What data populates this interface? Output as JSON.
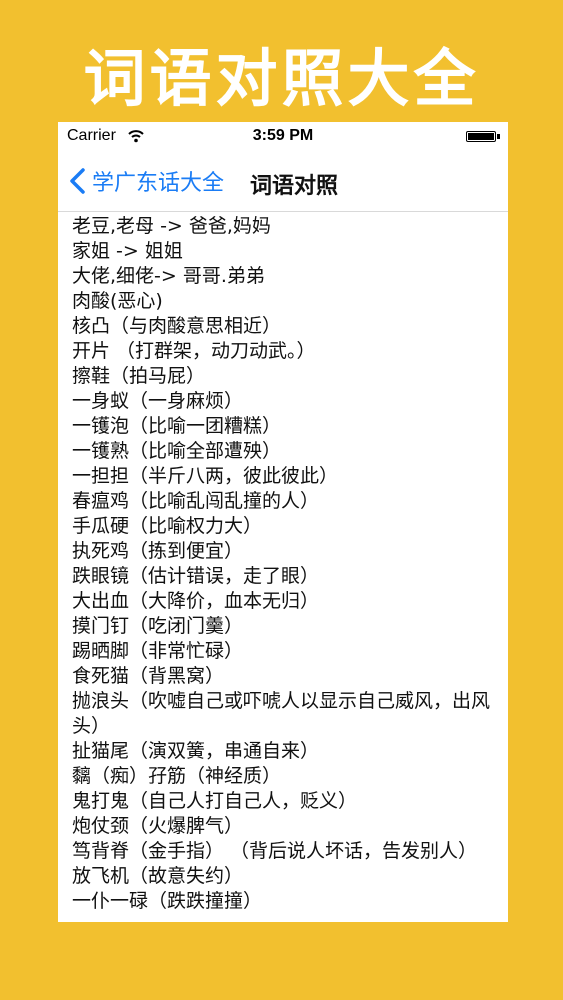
{
  "banner": {
    "title": "词语对照大全"
  },
  "status_bar": {
    "carrier": "Carrier",
    "time": "3:59 PM"
  },
  "nav": {
    "back_label": "学广东话大全",
    "title": "词语对照"
  },
  "entries": [
    "老豆,老母 -> 爸爸,妈妈",
    "家姐 -> 姐姐",
    "大佬,细佬-> 哥哥.弟弟",
    "肉酸(恶心)",
    "核凸（与肉酸意思相近）",
    "开片 （打群架，动刀动武。）",
    "擦鞋（拍马屁）",
    "一身蚁（一身麻烦）",
    "一镬泡（比喻一团糟糕）",
    "一镬熟（比喻全部遭殃）",
    "一担担（半斤八两，彼此彼此）",
    "春瘟鸡（比喻乱闯乱撞的人）",
    "手瓜硬（比喻权力大）",
    "执死鸡（拣到便宜）",
    "跌眼镜（估计错误，走了眼）",
    "大出血（大降价，血本无归）",
    "摸门钉（吃闭门羹）",
    "踢晒脚（非常忙碌）",
    "食死猫（背黑窝）",
    "抛浪头（吹嘘自己或吓唬人以显示自己威风，出风头）",
    "扯猫尾（演双簧，串通自来）",
    "黐（痴）孖筋（神经质）",
    "鬼打鬼（自己人打自己人，贬义）",
    "炮仗颈（火爆脾气）",
    "笃背脊（金手指） （背后说人坏话，告发别人）",
    "放飞机（故意失约）",
    "一仆一碌（跌跌撞撞）"
  ]
}
